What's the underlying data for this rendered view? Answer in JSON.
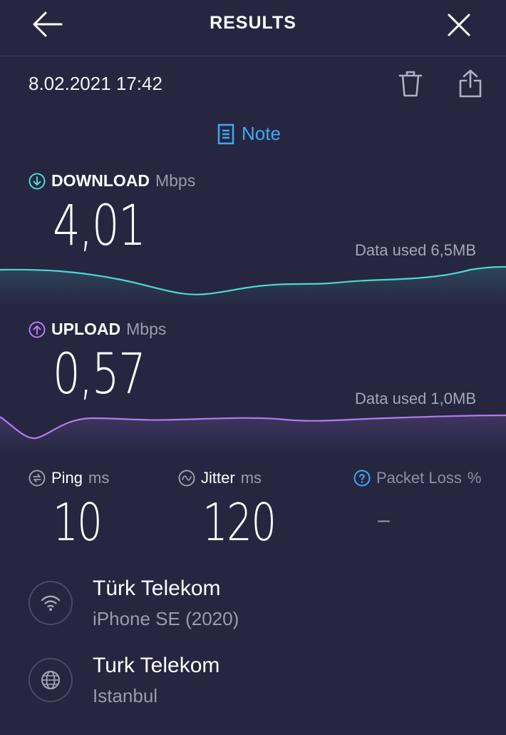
{
  "header": {
    "title": "RESULTS"
  },
  "test": {
    "datetime": "8.02.2021 17:42",
    "note_label": "Note"
  },
  "download": {
    "label": "DOWNLOAD",
    "unit": "Mbps",
    "value": "4,01",
    "data_used": "Data used 6,5MB",
    "color": "#4fd6d0"
  },
  "upload": {
    "label": "UPLOAD",
    "unit": "Mbps",
    "value": "0,57",
    "data_used": "Data used 1,0MB",
    "color": "#b07cf0"
  },
  "ping": {
    "label": "Ping",
    "unit": "ms",
    "value": "10"
  },
  "jitter": {
    "label": "Jitter",
    "unit": "ms",
    "value": "120"
  },
  "packet_loss": {
    "label": "Packet Loss",
    "unit": "%",
    "value": "–"
  },
  "connection": {
    "provider": "Türk Telekom",
    "device": "iPhone SE (2020)"
  },
  "server": {
    "name": "Turk Telekom",
    "location": "Istanbul"
  },
  "colors": {
    "background": "#262640",
    "accent": "#3fa8f5"
  },
  "icons": {
    "back": "arrow-left-icon",
    "close": "close-icon",
    "delete": "trash-icon",
    "share": "share-icon",
    "note": "note-icon",
    "download": "download-arrow-icon",
    "upload": "upload-arrow-icon",
    "ping": "ping-icon",
    "jitter": "jitter-icon",
    "packet_loss": "help-icon",
    "wifi": "wifi-icon",
    "globe": "globe-icon"
  }
}
